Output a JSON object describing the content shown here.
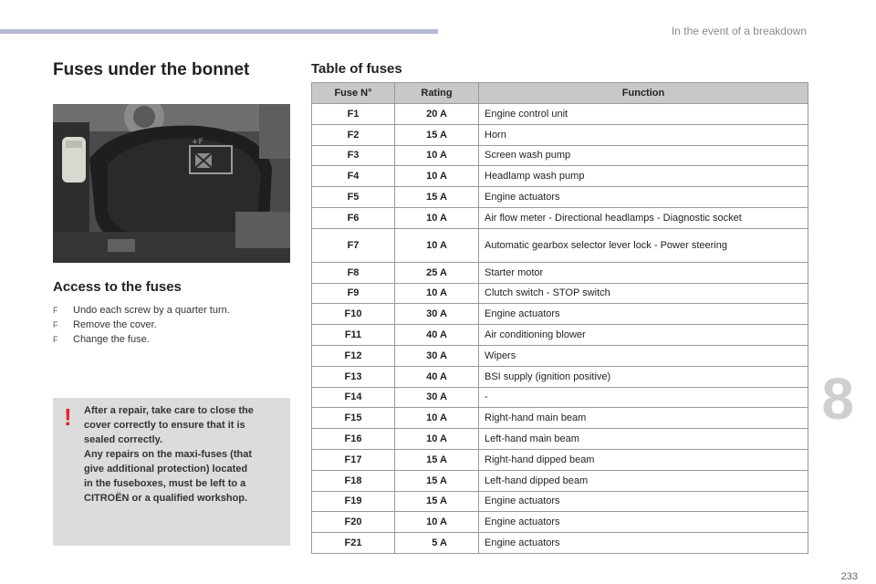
{
  "header": {
    "section": "In the event of a breakdown"
  },
  "left": {
    "title": "Fuses under the bonnet",
    "access_title": "Access to the fuses",
    "bullet_symbol": "F",
    "steps": [
      "Undo each screw by a quarter turn.",
      "Remove the cover.",
      "Change the fuse."
    ],
    "warning_symbol": "!",
    "warning_lines": [
      "After a repair, take care to close the",
      "cover correctly to ensure that it is",
      "sealed correctly.",
      "Any repairs on the maxi-fuses (that",
      "give additional protection) located",
      "in the fuseboxes, must be left to a",
      "CITROËN or a qualified workshop."
    ]
  },
  "table": {
    "title": "Table of fuses",
    "headers": [
      "Fuse N°",
      "Rating",
      "Function"
    ],
    "rows": [
      [
        "F1",
        "20 A",
        "Engine control unit"
      ],
      [
        "F2",
        "15 A",
        "Horn"
      ],
      [
        "F3",
        "10 A",
        "Screen wash pump"
      ],
      [
        "F4",
        "10 A",
        "Headlamp wash pump"
      ],
      [
        "F5",
        "15 A",
        "Engine actuators"
      ],
      [
        "F6",
        "10 A",
        "Air flow meter - Directional headlamps - Diagnostic socket"
      ],
      [
        "F7",
        "10 A",
        "Automatic gearbox selector lever lock - Power steering"
      ],
      [
        "F8",
        "25 A",
        "Starter motor"
      ],
      [
        "F9",
        "10 A",
        "Clutch switch - STOP switch"
      ],
      [
        "F10",
        "30 A",
        "Engine actuators"
      ],
      [
        "F11",
        "40 A",
        "Air conditioning blower"
      ],
      [
        "F12",
        "30 A",
        "Wipers"
      ],
      [
        "F13",
        "40 A",
        "BSI supply (ignition positive)"
      ],
      [
        "F14",
        "30 A",
        "-"
      ],
      [
        "F15",
        "10 A",
        "Right-hand main beam"
      ],
      [
        "F16",
        "10 A",
        "Left-hand main beam"
      ],
      [
        "F17",
        "15 A",
        "Right-hand dipped beam"
      ],
      [
        "F18",
        "15 A",
        "Left-hand dipped beam"
      ],
      [
        "F19",
        "15 A",
        "Engine actuators"
      ],
      [
        "F20",
        "10 A",
        "Engine actuators"
      ],
      [
        "F21",
        "5 A",
        "Engine actuators"
      ]
    ]
  },
  "chapter": "8",
  "page_number": "233"
}
